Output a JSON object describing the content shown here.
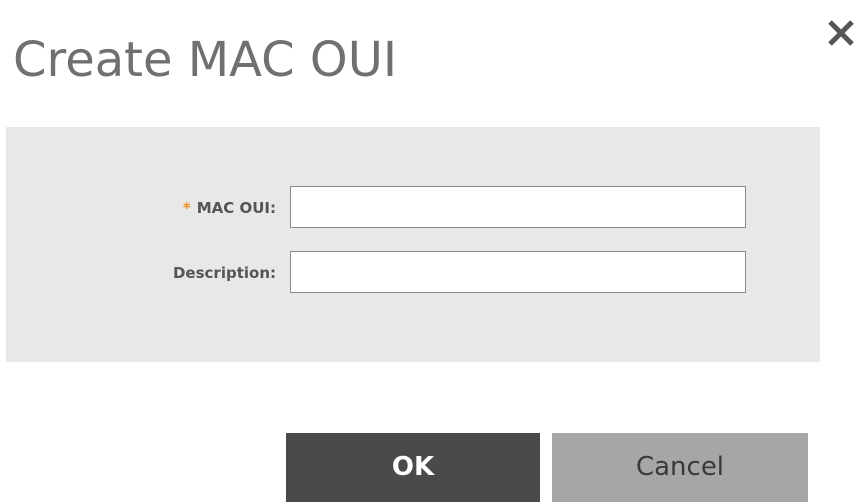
{
  "dialog": {
    "title": "Create MAC OUI",
    "close_icon": "close-icon"
  },
  "form": {
    "mac_oui": {
      "required_marker": "*",
      "label": "MAC OUI:",
      "value": "",
      "placeholder": ""
    },
    "description": {
      "label": "Description:",
      "value": "",
      "placeholder": ""
    }
  },
  "buttons": {
    "ok_label": "OK",
    "cancel_label": "Cancel"
  },
  "colors": {
    "title": "#707070",
    "panel_background": "#e8e8e8",
    "required_marker": "#f29124",
    "ok_button": "#4a4a4a",
    "cancel_button": "#a6a6a6"
  }
}
